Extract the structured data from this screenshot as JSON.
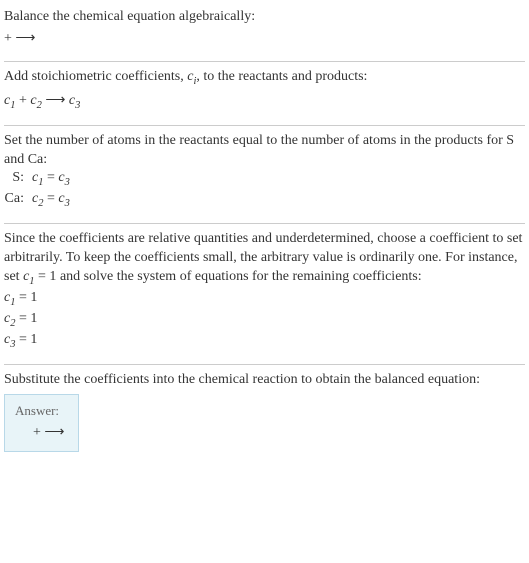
{
  "header": {
    "title": "Balance the chemical equation algebraically:",
    "reaction": " + ⟶"
  },
  "stoich": {
    "intro_a": "Add stoichiometric coefficients, ",
    "intro_ci": "c",
    "intro_ci_sub": "i",
    "intro_b": ", to the reactants and products:",
    "c1": "c",
    "c1_sub": "1",
    "plus": " + ",
    "c2": "c",
    "c2_sub": "2",
    "arrow": " ⟶ ",
    "c3": "c",
    "c3_sub": "3"
  },
  "atoms": {
    "intro": "Set the number of atoms in the reactants equal to the number of atoms in the products for S and Ca:",
    "rows": [
      {
        "label": "S:",
        "lhs_c": "c",
        "lhs_sub": "1",
        "eq": " = ",
        "rhs_c": "c",
        "rhs_sub": "3"
      },
      {
        "label": "Ca:",
        "lhs_c": "c",
        "lhs_sub": "2",
        "eq": " = ",
        "rhs_c": "c",
        "rhs_sub": "3"
      }
    ]
  },
  "solve": {
    "intro_a": "Since the coefficients are relative quantities and underdetermined, choose a coefficient to set arbitrarily. To keep the coefficients small, the arbitrary value is ordinarily one. For instance, set ",
    "set_c": "c",
    "set_sub": "1",
    "set_eq": " = 1",
    "intro_b": " and solve the system of equations for the remaining coefficients:",
    "results": [
      {
        "c": "c",
        "sub": "1",
        "val": " = 1"
      },
      {
        "c": "c",
        "sub": "2",
        "val": " = 1"
      },
      {
        "c": "c",
        "sub": "3",
        "val": " = 1"
      }
    ]
  },
  "final": {
    "intro": "Substitute the coefficients into the chemical reaction to obtain the balanced equation:",
    "answer_label": "Answer:",
    "answer_reaction": " + ⟶"
  }
}
